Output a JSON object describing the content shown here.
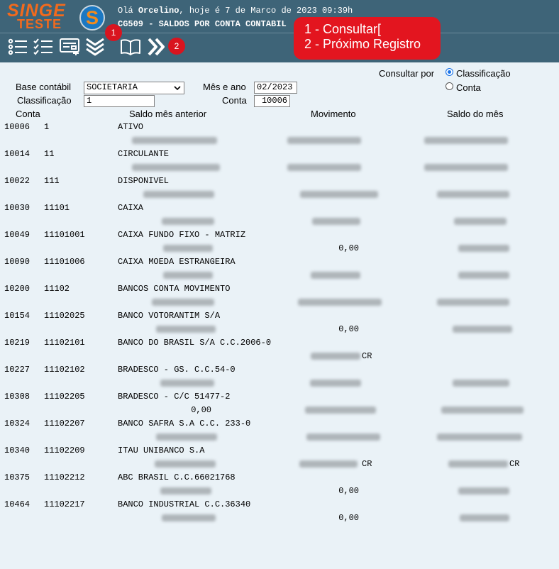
{
  "app": {
    "logo_top": "SINGE",
    "logo_bottom": "TESTE",
    "greeting_prefix": "Olá",
    "user": "Orcelino",
    "greeting_suffix": ", hoje é 7 de Marco de 2023 09:39h",
    "screen_title": "CG509 - SALDOS POR CONTA CONTABIL"
  },
  "annotations": {
    "badge1": "1",
    "badge2": "2",
    "callout_line1": "1 - Consultar[",
    "callout_line2": "2 - Próximo Registro"
  },
  "toolbar": {
    "icons": [
      "list-icon",
      "checklist-icon",
      "card-icon",
      "chevrons-down-icon",
      "book-icon",
      "double-chevron-right-icon"
    ]
  },
  "form": {
    "base_label": "Base contábil",
    "base_value": "SOCIETARIA",
    "classificacao_label": "Classificação",
    "classificacao_value": "1",
    "mes_ano_label": "Mês e ano",
    "mes_ano_value": "02/2023",
    "conta_label": "Conta",
    "conta_value": "10006",
    "consultar_por_label": "Consultar por",
    "radio_classificacao": "Classificação",
    "radio_conta": "Conta",
    "selected": "Classificação"
  },
  "table": {
    "headers": {
      "conta": "Conta",
      "saldo_anterior": "Saldo mês anterior",
      "movimento": "Movimento",
      "saldo_mes": "Saldo do mês"
    },
    "rows": [
      {
        "code": "10006",
        "class": "1",
        "name": "ATIVO",
        "prev": "",
        "mov": "",
        "mov_cr": "",
        "saldo": "",
        "saldo_cr": ""
      },
      {
        "code": "10014",
        "class": "11",
        "name": "CIRCULANTE",
        "prev": "",
        "mov": "",
        "mov_cr": "",
        "saldo": "",
        "saldo_cr": ""
      },
      {
        "code": "10022",
        "class": "111",
        "name": "DISPONIVEL",
        "prev": "",
        "mov": "",
        "mov_cr": "",
        "saldo": "",
        "saldo_cr": ""
      },
      {
        "code": "10030",
        "class": "11101",
        "name": "CAIXA",
        "prev": "",
        "mov": "",
        "mov_cr": "",
        "saldo": "",
        "saldo_cr": ""
      },
      {
        "code": "10049",
        "class": "11101001",
        "name": "CAIXA FUNDO FIXO - MATRIZ",
        "prev": "",
        "mov": "0,00",
        "mov_cr": "",
        "saldo": "",
        "saldo_cr": ""
      },
      {
        "code": "10090",
        "class": "11101006",
        "name": "CAIXA MOEDA ESTRANGEIRA",
        "prev": "",
        "mov": "",
        "mov_cr": "",
        "saldo": "",
        "saldo_cr": ""
      },
      {
        "code": "10200",
        "class": "11102",
        "name": "BANCOS CONTA MOVIMENTO",
        "prev": "",
        "mov": "",
        "mov_cr": "",
        "saldo": "",
        "saldo_cr": ""
      },
      {
        "code": "10154",
        "class": "11102025",
        "name": "BANCO VOTORANTIM S/A",
        "prev": "",
        "mov": "0,00",
        "mov_cr": "",
        "saldo": "",
        "saldo_cr": ""
      },
      {
        "code": "10219",
        "class": "11102101",
        "name": "BANCO DO BRASIL S/A C.C.2006-0",
        "prev": "",
        "mov": "",
        "mov_cr": "CR",
        "saldo": "",
        "saldo_cr": ""
      },
      {
        "code": "10227",
        "class": "11102102",
        "name": "BRADESCO - GS. C.C.54-0",
        "prev": "",
        "mov": "",
        "mov_cr": "",
        "saldo": "",
        "saldo_cr": ""
      },
      {
        "code": "10308",
        "class": "11102205",
        "name": "BRADESCO - C/C 51477-2",
        "prev": "0,00",
        "mov": "",
        "mov_cr": "",
        "saldo": "",
        "saldo_cr": ""
      },
      {
        "code": "10324",
        "class": "11102207",
        "name": "BANCO SAFRA S.A C.C. 233-0",
        "prev": "",
        "mov": "",
        "mov_cr": "",
        "saldo": "",
        "saldo_cr": ""
      },
      {
        "code": "10340",
        "class": "11102209",
        "name": "ITAU UNIBANCO S.A",
        "prev": "",
        "mov": "",
        "mov_cr": "CR",
        "saldo": "",
        "saldo_cr": "CR"
      },
      {
        "code": "10375",
        "class": "11102212",
        "name": "ABC BRASIL C.C.66021768",
        "prev": "",
        "mov": "0,00",
        "mov_cr": "",
        "saldo": "",
        "saldo_cr": ""
      },
      {
        "code": "10464",
        "class": "11102217",
        "name": "BANCO INDUSTRIAL C.C.36340",
        "prev": "",
        "mov": "0,00",
        "mov_cr": "",
        "saldo": "",
        "saldo_cr": ""
      }
    ]
  }
}
